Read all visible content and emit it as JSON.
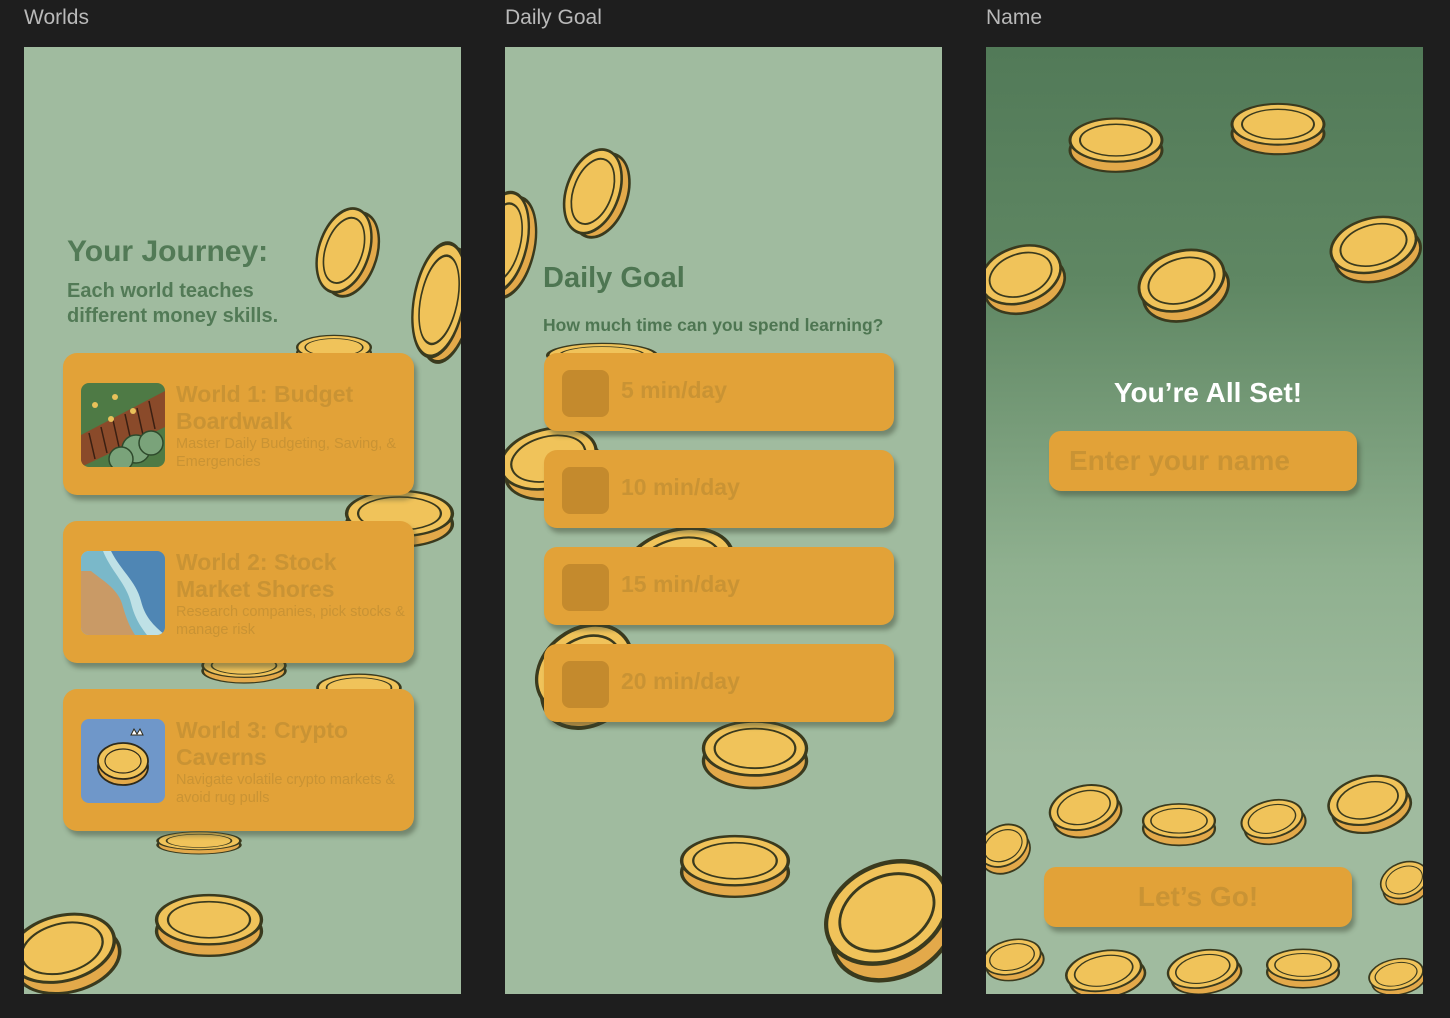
{
  "frames": {
    "worlds": {
      "label": "Worlds"
    },
    "daily_goal": {
      "label": "Daily Goal"
    },
    "name": {
      "label": "Name"
    }
  },
  "worlds": {
    "title": "Your Journey:",
    "subtitle": "Each world teaches different money skills.",
    "items": [
      {
        "name": "World 1: Budget Boardwalk",
        "description": "Master Daily Budgeting, Saving, & Emergencies",
        "thumbnail_icon": "boardwalk-icon"
      },
      {
        "name": "World 2: Stock Market Shores",
        "description": "Research companies, pick stocks & manage risk",
        "thumbnail_icon": "shore-icon"
      },
      {
        "name": "World 3: Crypto Caverns",
        "description": "Navigate volatile crypto markets & avoid rug pulls",
        "thumbnail_icon": "crowned-coin-icon"
      }
    ]
  },
  "daily_goal": {
    "title": "Daily Goal",
    "question": "How much time can you spend learning?",
    "options": [
      "5 min/day",
      "10 min/day",
      "15 min/day",
      "20 min/day"
    ]
  },
  "name_screen": {
    "title": "You’re All Set!",
    "input_placeholder": "Enter your name",
    "input_value": "",
    "button_label": "Let’s Go!"
  },
  "colors": {
    "app_background": "#1e1e1e",
    "screen_background": "#a0bb9f",
    "heading_green": "#527a56",
    "card_orange": "#e2a238",
    "card_text": "#c99334",
    "coin_fill": "#f0c35a",
    "coin_outline": "#3a3a1e"
  }
}
